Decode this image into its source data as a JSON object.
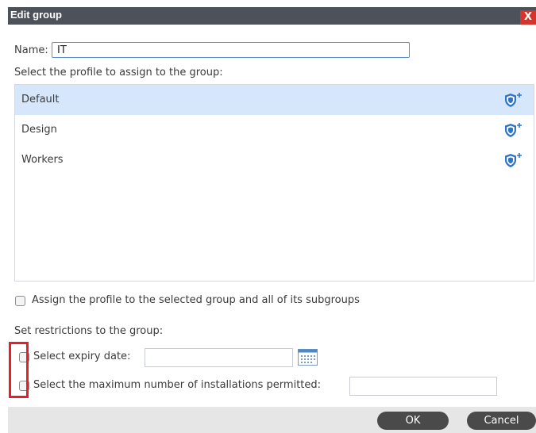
{
  "window": {
    "title": "Edit group",
    "close_label": "X"
  },
  "name": {
    "label": "Name:",
    "value": "IT"
  },
  "profiles": {
    "label": "Select the profile to assign to the group:",
    "items": [
      {
        "label": "Default",
        "selected": true,
        "icon": "shield-add-icon"
      },
      {
        "label": "Design",
        "selected": false,
        "icon": "shield-add-icon"
      },
      {
        "label": "Workers",
        "selected": false,
        "icon": "shield-add-icon"
      }
    ]
  },
  "subgroups_option": {
    "label": "Assign the profile to the selected group and all of its subgroups",
    "checked": false
  },
  "restrictions": {
    "label": "Set restrictions to the group:",
    "expiry": {
      "label": "Select expiry date:",
      "value": "",
      "checked": false
    },
    "max_installations": {
      "label": "Select the maximum number of installations permitted:",
      "value": "",
      "checked": false
    }
  },
  "buttons": {
    "ok": "OK",
    "cancel": "Cancel"
  },
  "colors": {
    "accent": "#5a8fd0",
    "selected_row": "#d6e6fb",
    "titlebar": "#4d5159",
    "close": "#d7352b",
    "highlight": "#e5202b",
    "button": "#4a4a4a"
  }
}
